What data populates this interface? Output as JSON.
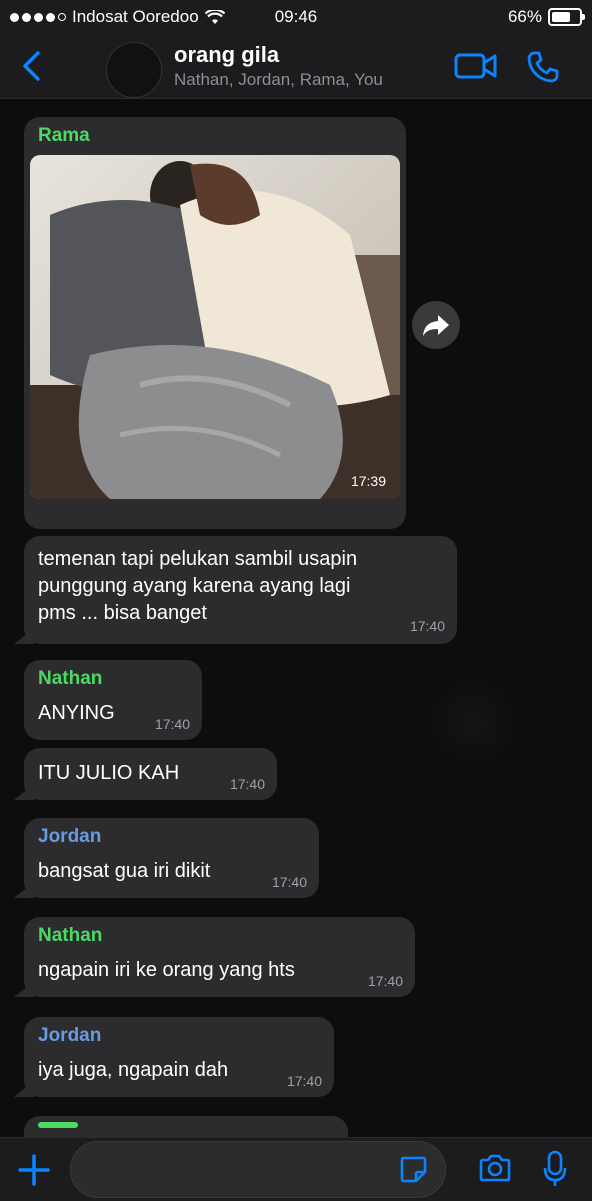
{
  "status_bar": {
    "carrier": "Indosat Ooredoo",
    "time": "09:46",
    "battery": "66%"
  },
  "header": {
    "title": "orang gila",
    "members": "Nathan, Jordan, Rama, You"
  },
  "messages": [
    {
      "sender": "Rama",
      "type": "image",
      "time": "17:39"
    },
    {
      "type": "text",
      "lines": [
        "temenan tapi pelukan sambil usapin",
        "punggung ayang karena ayang lagi",
        "pms ... bisa banget"
      ],
      "time": "17:40"
    },
    {
      "sender": "Nathan",
      "type": "text",
      "text": "ANYING",
      "time": "17:40"
    },
    {
      "type": "text",
      "text": "ITU JULIO KAH",
      "time": "17:40"
    },
    {
      "sender": "Jordan",
      "type": "text",
      "text": "bangsat gua iri dikit",
      "time": "17:40"
    },
    {
      "sender": "Nathan",
      "type": "text",
      "text": "ngapain iri ke orang yang hts",
      "time": "17:40"
    },
    {
      "sender": "Jordan",
      "type": "text",
      "text": "iya juga, ngapain dah",
      "time": "17:40"
    }
  ],
  "colors": {
    "accent": "#0a84ff",
    "rama": "#4cd964",
    "nathan": "#4cd964",
    "jordan": "#6a9ae0",
    "bubble": "#2c2c2e"
  },
  "icons": {
    "back": "chevron-left-icon",
    "video": "video-camera-icon",
    "phone": "phone-icon",
    "forward": "forward-arrow-icon",
    "add": "plus-icon",
    "sticker": "sticker-icon",
    "camera": "camera-icon",
    "mic": "microphone-icon"
  }
}
